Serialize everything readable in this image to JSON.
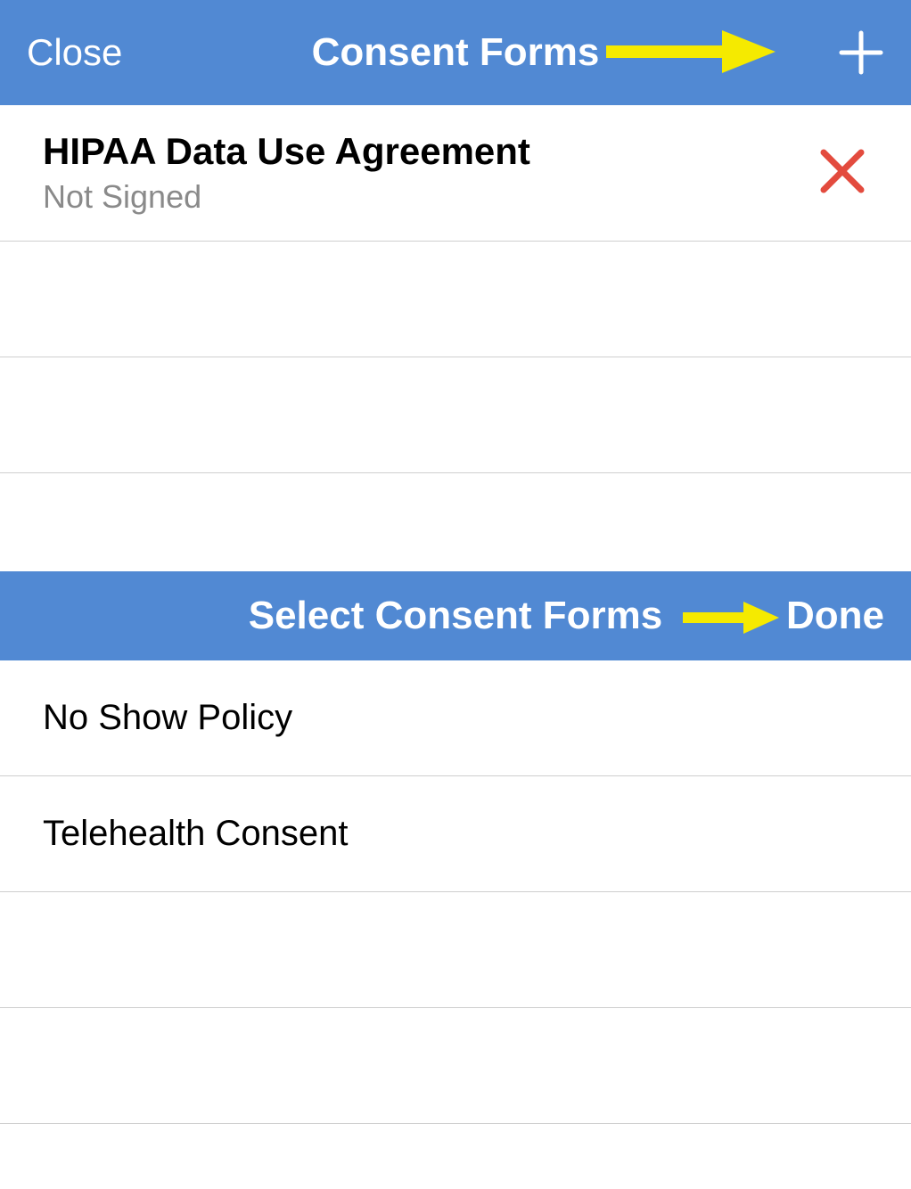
{
  "top": {
    "close_label": "Close",
    "title": "Consent Forms",
    "rows": [
      {
        "title": "HIPAA Data Use Agreement",
        "status": "Not Signed"
      }
    ]
  },
  "bottom": {
    "title": "Select Consent Forms",
    "done_label": "Done",
    "items": [
      {
        "label": "No Show Policy"
      },
      {
        "label": "Telehealth Consent"
      }
    ]
  }
}
